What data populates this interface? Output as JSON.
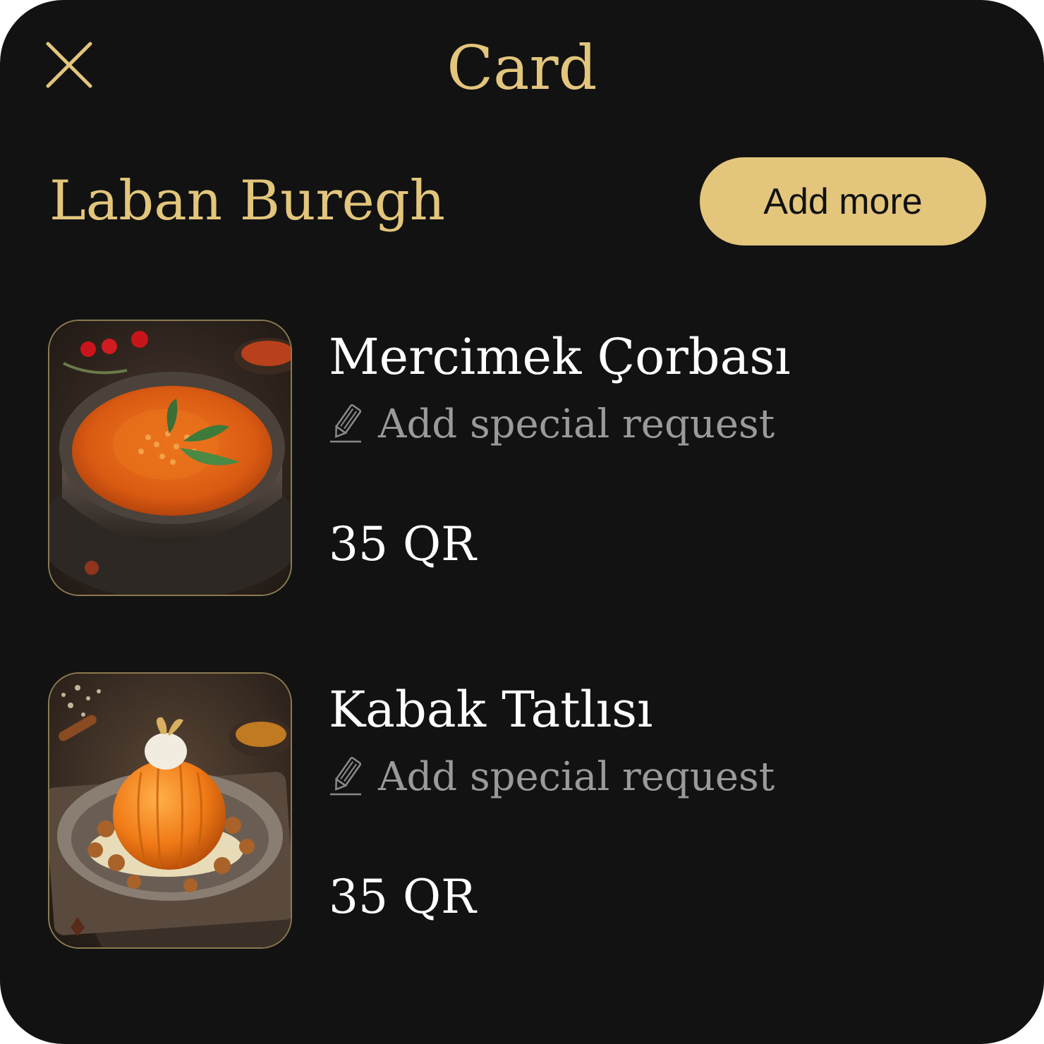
{
  "header": {
    "title": "Card",
    "close_icon": "close-icon"
  },
  "restaurant": {
    "name": "Laban Buregh",
    "add_more_label": "Add more"
  },
  "cart": {
    "items": [
      {
        "name": "Mercimek Çorbası",
        "request_label": "Add special request",
        "price": "35 QR",
        "image": "lentil-soup-bowl"
      },
      {
        "name": "Kabak Tatlısı",
        "request_label": "Add special request",
        "price": "35 QR",
        "image": "pumpkin-dessert-plate"
      }
    ]
  },
  "colors": {
    "background": "#121212",
    "accent_gold": "#e3c67c",
    "text_primary": "#ffffff",
    "text_muted": "#9a9a9a"
  }
}
